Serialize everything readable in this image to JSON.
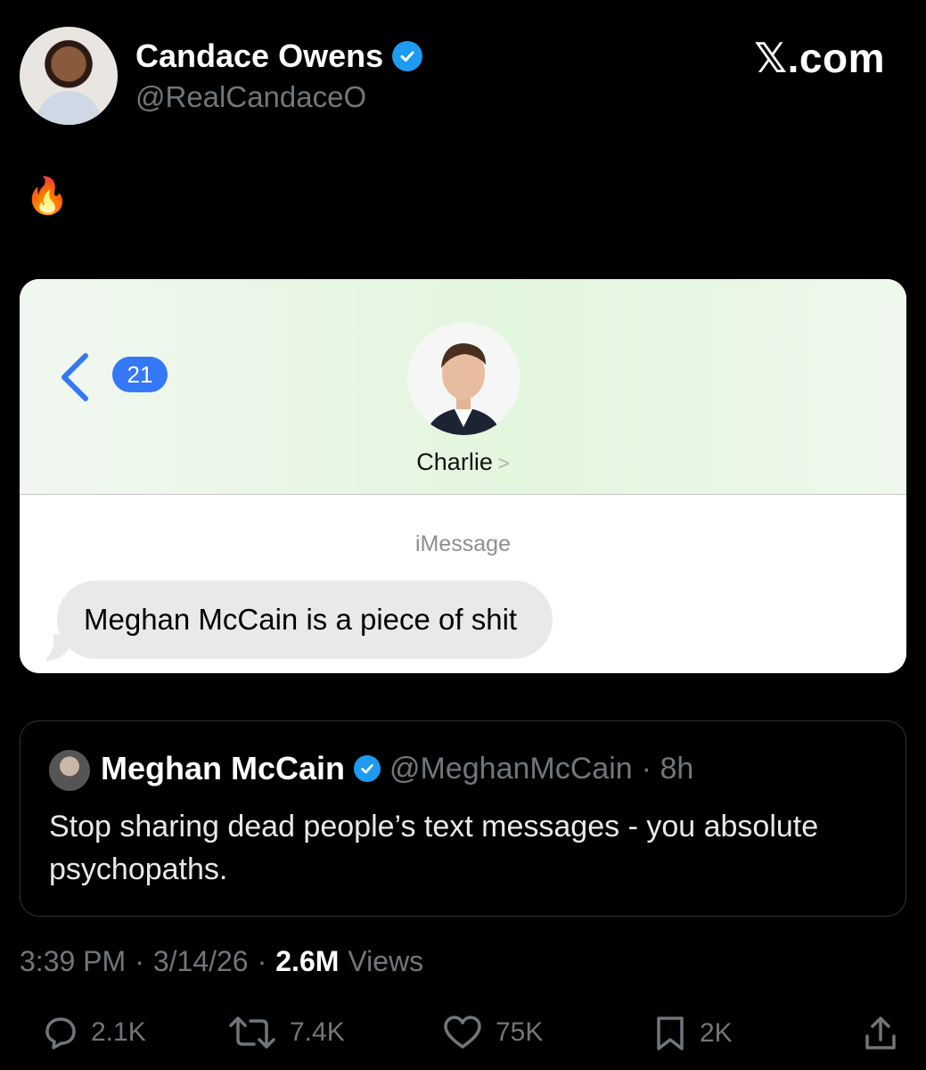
{
  "author": {
    "name": "Candace Owens",
    "handle": "@RealCandaceO",
    "verified": true
  },
  "brand": "𝕏.com",
  "tweet_text": "🔥",
  "media": {
    "back_badge_count": "21",
    "contact_name": "Charlie",
    "service_label": "iMessage",
    "message": "Meghan McCain is a piece of shit",
    "accent_color": "#3478f6"
  },
  "quoted": {
    "name": "Meghan McCain",
    "handle": "@MeghanMcCain",
    "time": "· 8h",
    "verified": true,
    "text": "Stop sharing dead people’s text messages - you absolute psychopaths."
  },
  "meta": {
    "time": "3:39 PM",
    "sep1": "·",
    "date": "3/14/26",
    "sep2": "·",
    "views": "2.6M",
    "views_label": "Views"
  },
  "actions": {
    "replies": "2.1K",
    "reposts": "7.4K",
    "likes": "75K",
    "bookmarks": "2K"
  },
  "colors": {
    "background": "#000000",
    "verified_blue": "#1d9bf0",
    "muted": "#71767b"
  }
}
